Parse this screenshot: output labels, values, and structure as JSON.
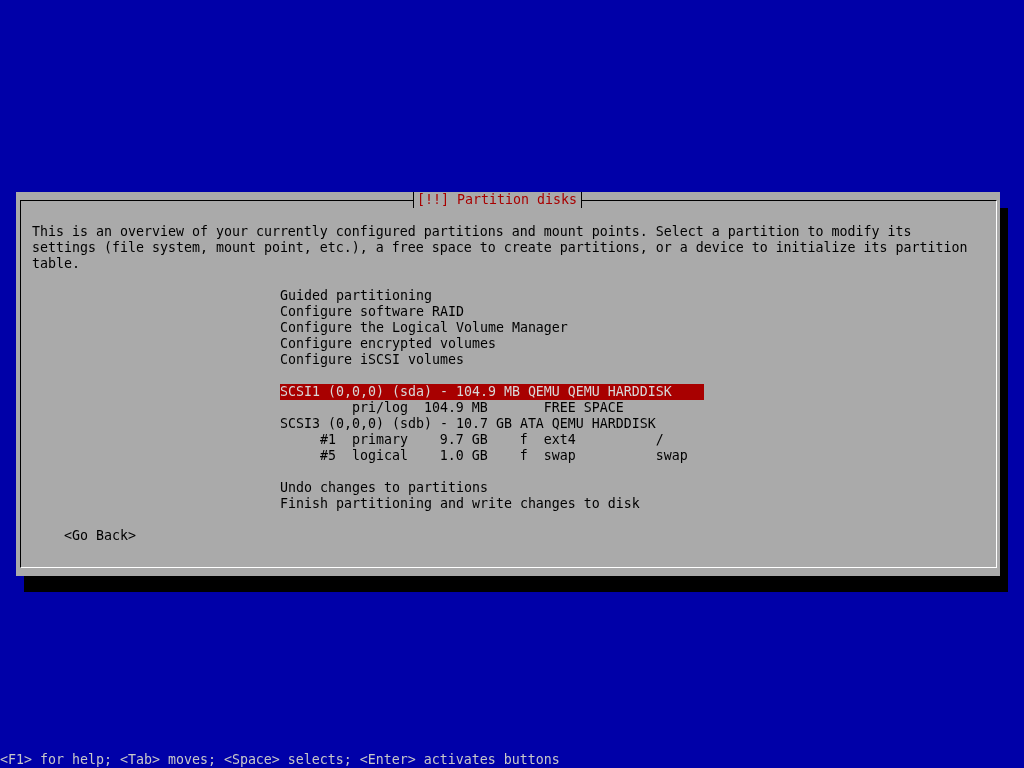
{
  "dialog": {
    "title": "[!!] Partition disks",
    "message": "This is an overview of your currently configured partitions and mount points. Select a partition to modify its settings (file system, mount point, etc.), a free space to create partitions, or a device to initialize its partition table.",
    "actions": [
      {
        "label": "Guided partitioning",
        "selected": false
      },
      {
        "label": "Configure software RAID",
        "selected": false
      },
      {
        "label": "Configure the Logical Volume Manager",
        "selected": false
      },
      {
        "label": "Configure encrypted volumes",
        "selected": false
      },
      {
        "label": "Configure iSCSI volumes",
        "selected": false
      }
    ],
    "devices": [
      {
        "kind": "disk",
        "label": "SCSI1 (0,0,0) (sda) - 104.9 MB QEMU QEMU HARDDISK",
        "selected": true
      },
      {
        "kind": "partition",
        "type": "pri/log",
        "size": "104.9 MB",
        "filesystem": "FREE SPACE",
        "selected": false
      },
      {
        "kind": "disk",
        "label": "SCSI3 (0,0,0) (sdb) - 10.7 GB ATA QEMU HARDDISK",
        "selected": false
      },
      {
        "kind": "partition",
        "number": "#1",
        "type": "primary",
        "size": "9.7 GB",
        "flag": "f",
        "filesystem": "ext4",
        "mount": "/",
        "selected": false
      },
      {
        "kind": "partition",
        "number": "#5",
        "type": "logical",
        "size": "1.0 GB",
        "flag": "f",
        "filesystem": "swap",
        "mount": "swap",
        "selected": false
      }
    ],
    "finish_actions": [
      {
        "label": "Undo changes to partitions",
        "selected": false
      },
      {
        "label": "Finish partitioning and write changes to disk",
        "selected": false
      }
    ],
    "back_button": {
      "label": "<Go Back>",
      "selected": false
    }
  },
  "status_bar": "<F1> for help; <Tab> moves; <Space> selects; <Enter> activates buttons"
}
